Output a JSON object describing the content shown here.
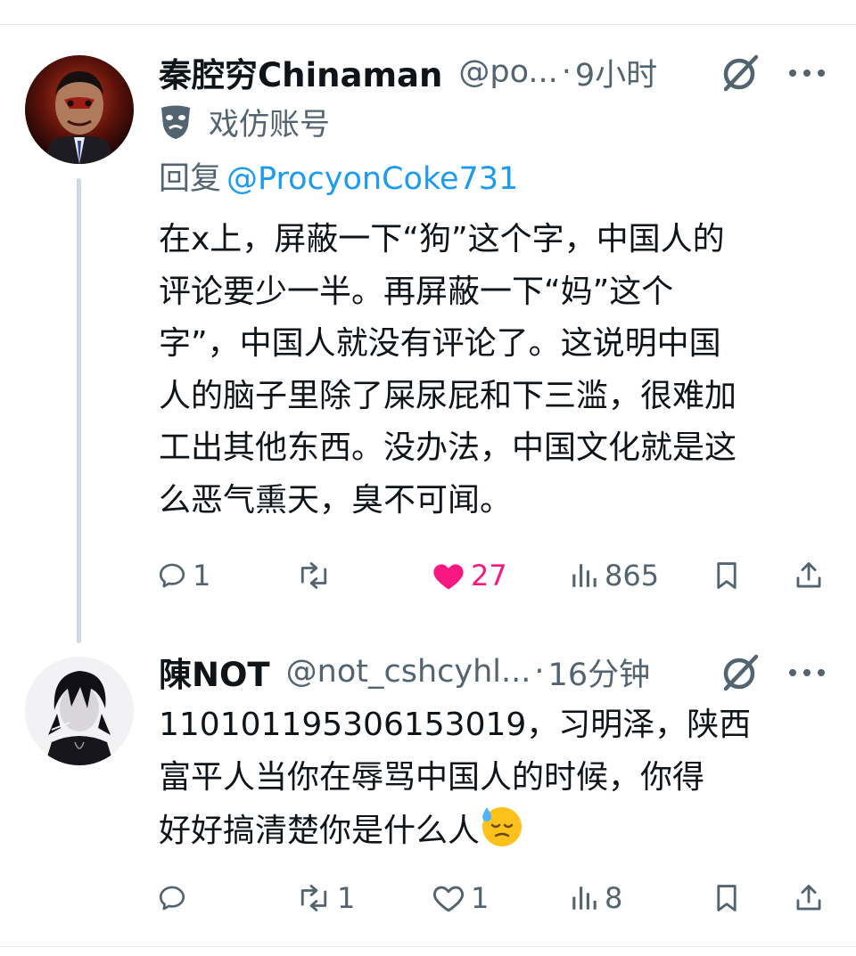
{
  "tweet1": {
    "display_name": "秦腔穷Chinaman",
    "handle": "@po...",
    "separator": "·",
    "time": "9小时",
    "parody_label": "戏仿账号",
    "reply_prefix": "回复",
    "reply_handle": "@ProcyonCoke731",
    "text": "在x上，屏蔽一下“狗”这个字，中国人的\n评论要少一半。再屏蔽一下“妈”这个\n字”，中国人就没有评论了。这说明中国\n人的脑子里除了屎尿屁和下三滥，很难加\n工出其他东西。没办法，中国文化就是这\n么恶气熏天，臭不可闻。",
    "replies": "1",
    "reposts": "",
    "likes": "27",
    "views": "865",
    "liked": true
  },
  "tweet2": {
    "display_name": "陳NOT",
    "handle": "@not_cshcyhl...",
    "separator": "·",
    "time": "16分钟",
    "text_line1": "110101195306153019，习明泽，陕西",
    "text_line2": "富平人当你在辱骂中国人的时候，你得",
    "text_line3": "好好搞清楚你是什么人",
    "emoji": "downcast-face-with-sweat",
    "replies": "",
    "reposts": "1",
    "likes": "1",
    "views": "8"
  },
  "colors": {
    "text": "#0f1419",
    "secondary": "#536471",
    "link": "#1d9bf0",
    "like": "#f91880",
    "divider": "#e6ecf0",
    "thread_line": "#cfd9de"
  }
}
